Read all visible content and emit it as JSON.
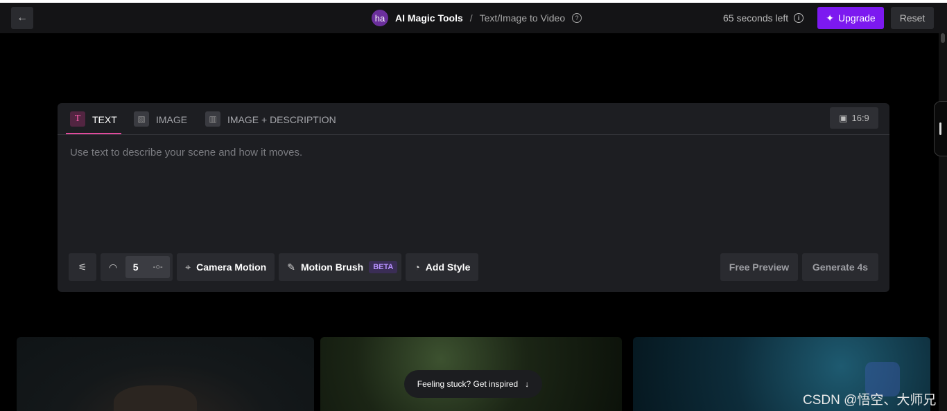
{
  "header": {
    "back_icon": "arrow-left-icon",
    "avatar_initials": "ha",
    "breadcrumb_root": "AI Magic Tools",
    "breadcrumb_separator": "/",
    "breadcrumb_current": "Text/Image to Video",
    "timer_text": "65 seconds left",
    "upgrade_label": "Upgrade",
    "reset_label": "Reset",
    "accent_color": "#7c19f0"
  },
  "panel": {
    "tabs": [
      {
        "label": "TEXT",
        "icon": "text-icon",
        "active": true
      },
      {
        "label": "IMAGE",
        "icon": "image-icon",
        "active": false
      },
      {
        "label": "IMAGE + DESCRIPTION",
        "icon": "split-image-icon",
        "active": false
      }
    ],
    "aspect_ratio": "16:9",
    "prompt_placeholder": "Use text to describe your scene and how it moves.",
    "toolbar": {
      "settings_icon": "sliders-icon",
      "motion_speed_icon": "speedometer-icon",
      "motion_value": "5",
      "camera_motion_label": "Camera Motion",
      "motion_brush_label": "Motion Brush",
      "motion_brush_badge": "BETA",
      "add_style_label": "Add Style"
    },
    "free_preview_label": "Free Preview",
    "generate_label": "Generate 4s"
  },
  "gallery": {
    "inspire_label": "Feeling stuck? Get inspired"
  },
  "watermark": "CSDN @悟空、大师兄"
}
